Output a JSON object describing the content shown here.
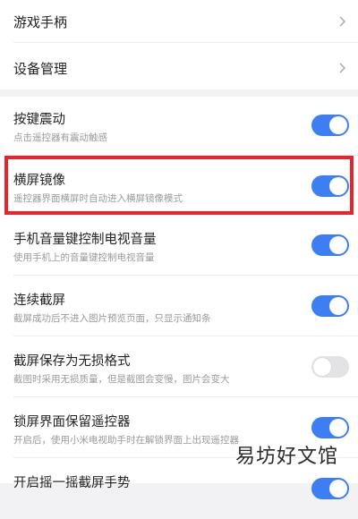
{
  "nav_items": [
    {
      "label": "游戏手柄"
    },
    {
      "label": "设备管理"
    }
  ],
  "settings": [
    {
      "title": "按键震动",
      "subtitle": "点击遥控器有震动触感",
      "enabled": true
    },
    {
      "title": "横屏镜像",
      "subtitle": "遥控器界面横屏时自动进入横屏镜像模式",
      "enabled": true
    },
    {
      "title": "手机音量键控制电视音量",
      "subtitle": "使用手机上的音量键控制电视音量",
      "enabled": true
    },
    {
      "title": "连续截屏",
      "subtitle": "截屏成功后不进入图片预览页面，只显示通知条",
      "enabled": true
    },
    {
      "title": "截屏保存为无损格式",
      "subtitle": "截图时采用无损质量，但是截图会变慢，图片会变大",
      "enabled": false
    },
    {
      "title": "锁屏界面保留遥控器",
      "subtitle": "开启后，使用小米电视助手时在解锁界面上出现遥控器",
      "enabled": true
    },
    {
      "title": "开启摇一摇截屏手势",
      "subtitle": "",
      "enabled": true
    }
  ],
  "watermark": "易坊好文馆",
  "colors": {
    "toggle_on": "#3d7ff3",
    "highlight": "#e8252b"
  }
}
